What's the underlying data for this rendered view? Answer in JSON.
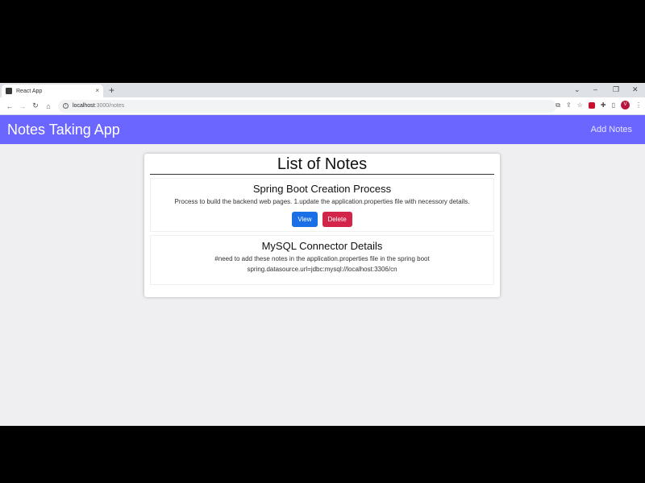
{
  "browser": {
    "tab_title": "React App",
    "tab_close": "×",
    "new_tab": "+",
    "url_host": "localhost",
    "url_path": ":3000/notes",
    "avatar_letter": "V",
    "min": "–",
    "max": "❐",
    "close": "✕",
    "back": "←",
    "forward": "→",
    "reload": "↻",
    "home": "⌂"
  },
  "navbar": {
    "brand": "Notes Taking App",
    "add_link": "Add Notes",
    "color": "#6b66ff"
  },
  "page": {
    "title": "List of Notes"
  },
  "notes": [
    {
      "title": "Spring Boot Creation Process",
      "body": "Process to build the backend web pages. 1.update the application.properties file with necessory details.",
      "view_label": "View",
      "delete_label": "Delete"
    },
    {
      "title": "MySQL Connector Details",
      "body_line1": "#need to add these notes in the application.properties file in the spring boot",
      "body_line2": "spring.datasource.url=jdbc:mysql://localhost:3306/cn"
    }
  ]
}
